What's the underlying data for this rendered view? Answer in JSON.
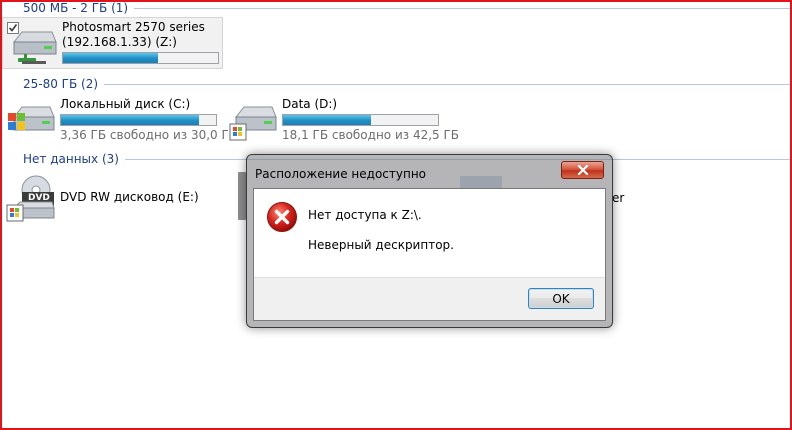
{
  "groups": [
    {
      "label": "500 МБ - 2 ГБ (1)"
    },
    {
      "label": "25-80 ГБ (2)"
    },
    {
      "label": "Нет данных (3)"
    }
  ],
  "drives": {
    "network": {
      "name": "Photosmart 2570 series",
      "subtitle": "(192.168.1.33) (Z:)",
      "used_fraction": 0.61,
      "icon": "network-drive-icon"
    },
    "local_c": {
      "name": "Локальный диск (C:)",
      "free": "3,36 ГБ свободно из 30,0 ГБ",
      "used_fraction": 0.89,
      "icon": "windows-drive-icon"
    },
    "data_d": {
      "name": "Data (D:)",
      "free": "18,1 ГБ свободно из 42,5 ГБ",
      "used_fraction": 0.57,
      "icon": "hard-drive-icon"
    },
    "dvd_e": {
      "name": "DVD RW дисковод (E:)",
      "icon": "dvd-drive-icon",
      "icon_label": "DVD"
    }
  },
  "dialog": {
    "title": "Расположение недоступно",
    "message": "Нет доступа к Z:\\.",
    "detail": "Неверный дескриптор.",
    "ok_label": "OK",
    "icon": "error-icon"
  },
  "background_fragment": "er",
  "colors": {
    "frame": "#e0141a",
    "group_text": "#1e3d8a",
    "bar_fill": "#1e8ec6"
  }
}
